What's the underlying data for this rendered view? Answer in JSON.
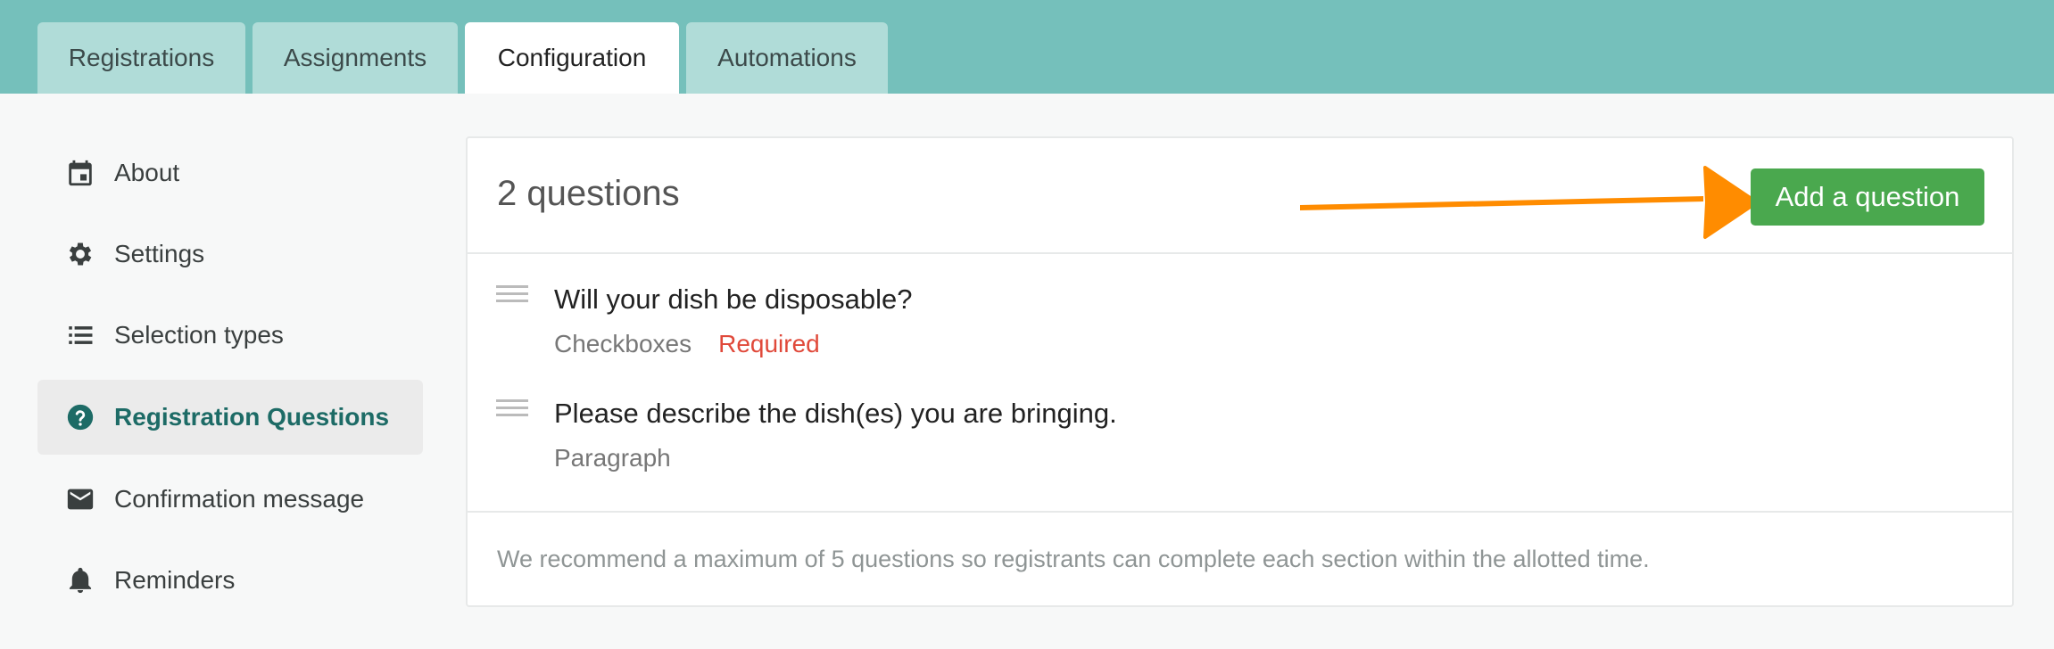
{
  "tabs": [
    {
      "label": "Registrations"
    },
    {
      "label": "Assignments"
    },
    {
      "label": "Configuration",
      "active": true
    },
    {
      "label": "Automations"
    }
  ],
  "sidebar": {
    "items": [
      {
        "label": "About",
        "icon": "calendar-icon"
      },
      {
        "label": "Settings",
        "icon": "gear-icon"
      },
      {
        "label": "Selection types",
        "icon": "list-icon"
      },
      {
        "label": "Registration Questions",
        "icon": "question-circle-icon",
        "active": true
      },
      {
        "label": "Confirmation message",
        "icon": "envelope-icon"
      },
      {
        "label": "Reminders",
        "icon": "bell-icon"
      }
    ]
  },
  "main": {
    "count_title": "2 questions",
    "add_button_label": "Add a question",
    "questions": [
      {
        "title": "Will your dish be disposable?",
        "type": "Checkboxes",
        "required": "Required"
      },
      {
        "title": "Please describe the dish(es) you are bringing.",
        "type": "Paragraph",
        "required": ""
      }
    ],
    "footer_note": "We recommend a maximum of 5 questions so registrants can complete each section within the allotted time."
  },
  "colors": {
    "tabbar_bg": "#75c0bb",
    "active_sidebar_text": "#1d6b66",
    "add_button": "#4aa84e",
    "required": "#e0493a",
    "annotation_arrow": "#ff8c00"
  }
}
